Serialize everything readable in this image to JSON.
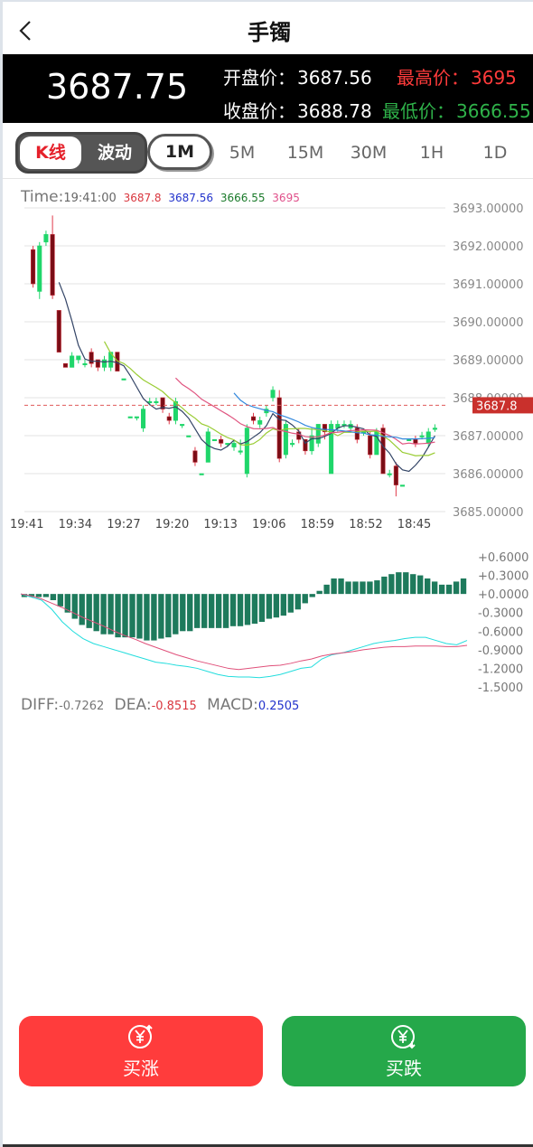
{
  "header": {
    "title": "手镯"
  },
  "quote": {
    "price": "3687.75",
    "open_label": "开盘价：",
    "open": "3687.56",
    "close_label": "收盘价：",
    "close": "3688.78",
    "high_label": "最高价：",
    "high": "3695",
    "low_label": "最低价：",
    "low": "3666.55"
  },
  "tabs": {
    "kline": "K线",
    "wave": "波动",
    "timeframes": [
      "1M",
      "5M",
      "15M",
      "30M",
      "1H",
      "1D"
    ],
    "active": "1M"
  },
  "legend": {
    "time_label": "Time:",
    "time": "19:41:00",
    "v1": "3687.8",
    "v2": "3687.56",
    "v3": "3666.55",
    "v4": "3695",
    "c1": "#d9363e",
    "c2": "#2233cc",
    "c3": "#1a7a2a",
    "c4": "#e0508a"
  },
  "chart_data": [
    {
      "type": "candlestick",
      "y_ticks": [
        "3693.00000",
        "3692.00000",
        "3691.00000",
        "3690.00000",
        "3689.00000",
        "3688.00000",
        "3687.00000",
        "3686.00000",
        "3685.00000"
      ],
      "ylim": [
        3685,
        3693
      ],
      "x_ticks": [
        "19:41",
        "19:34",
        "19:27",
        "19:20",
        "19:13",
        "19:06",
        "18:59",
        "18:52",
        "18:45"
      ],
      "current_price_label": "3687.8",
      "current_price": 3687.8,
      "colors": {
        "up": "#1fd66a",
        "down": "#7a0d16",
        "ma5": "#334466",
        "ma10": "#99cc33",
        "ma20": "#e05580",
        "ma30": "#3388dd"
      },
      "candles": [
        {
          "o": 3691.9,
          "c": 3691.0,
          "h": 3692.0,
          "l": 3690.9
        },
        {
          "o": 3690.8,
          "c": 3692.0,
          "h": 3692.1,
          "l": 3690.6
        },
        {
          "o": 3692.1,
          "c": 3692.3,
          "h": 3692.4,
          "l": 3692.0
        },
        {
          "o": 3692.3,
          "c": 3690.7,
          "h": 3692.8,
          "l": 3690.6
        },
        {
          "o": 3690.3,
          "c": 3689.2,
          "h": 3690.3,
          "l": 3689.2
        },
        {
          "o": 3688.9,
          "c": 3688.8,
          "h": 3688.9,
          "l": 3688.8
        },
        {
          "o": 3688.8,
          "c": 3689.1,
          "h": 3689.2,
          "l": 3688.8
        },
        {
          "o": 3689.0,
          "c": 3689.1,
          "h": 3689.1,
          "l": 3688.9
        },
        {
          "o": 3688.9,
          "c": 3688.9,
          "h": 3689.0,
          "l": 3688.8
        },
        {
          "o": 3689.2,
          "c": 3688.9,
          "h": 3689.3,
          "l": 3688.8
        },
        {
          "o": 3689.0,
          "c": 3688.8,
          "h": 3689.0,
          "l": 3688.7
        },
        {
          "o": 3688.8,
          "c": 3689.0,
          "h": 3689.1,
          "l": 3688.7
        },
        {
          "o": 3688.8,
          "c": 3689.2,
          "h": 3689.2,
          "l": 3688.7
        },
        {
          "o": 3689.2,
          "c": 3688.7,
          "h": 3689.2,
          "l": 3688.7
        },
        {
          "o": 3688.5,
          "c": 3688.5,
          "h": 3688.5,
          "l": 3688.5
        },
        {
          "o": 3687.5,
          "c": 3687.5,
          "h": 3687.5,
          "l": 3687.5
        },
        {
          "o": 3687.5,
          "c": 3687.5,
          "h": 3687.5,
          "l": 3687.4
        },
        {
          "o": 3687.2,
          "c": 3687.7,
          "h": 3687.8,
          "l": 3687.1
        },
        {
          "o": 3687.9,
          "c": 3687.9,
          "h": 3688.0,
          "l": 3687.8
        },
        {
          "o": 3687.9,
          "c": 3687.9,
          "h": 3688.0,
          "l": 3687.8
        },
        {
          "o": 3688.0,
          "c": 3687.7,
          "h": 3688.0,
          "l": 3687.6
        },
        {
          "o": 3687.5,
          "c": 3687.4,
          "h": 3687.6,
          "l": 3687.3
        },
        {
          "o": 3687.4,
          "c": 3687.9,
          "h": 3688.0,
          "l": 3687.3
        },
        {
          "o": 3687.3,
          "c": 3687.3,
          "h": 3687.3,
          "l": 3687.2
        },
        {
          "o": 3687.0,
          "c": 3687.0,
          "h": 3687.0,
          "l": 3687.0
        },
        {
          "o": 3686.6,
          "c": 3686.3,
          "h": 3686.7,
          "l": 3686.2
        },
        {
          "o": 3686.0,
          "c": 3686.0,
          "h": 3686.0,
          "l": 3686.0
        },
        {
          "o": 3686.3,
          "c": 3687.1,
          "h": 3687.2,
          "l": 3686.3
        },
        {
          "o": 3686.9,
          "c": 3686.9,
          "h": 3686.9,
          "l": 3686.9
        },
        {
          "o": 3686.9,
          "c": 3686.8,
          "h": 3687.0,
          "l": 3686.7
        },
        {
          "o": 3686.8,
          "c": 3686.8,
          "h": 3686.8,
          "l": 3686.7
        },
        {
          "o": 3686.7,
          "c": 3686.8,
          "h": 3686.9,
          "l": 3686.6
        },
        {
          "o": 3686.6,
          "c": 3686.6,
          "h": 3686.9,
          "l": 3686.5
        },
        {
          "o": 3686.0,
          "c": 3687.2,
          "h": 3687.3,
          "l": 3685.9
        },
        {
          "o": 3687.5,
          "c": 3687.4,
          "h": 3687.6,
          "l": 3687.3
        },
        {
          "o": 3687.3,
          "c": 3687.4,
          "h": 3687.5,
          "l": 3687.2
        },
        {
          "o": 3687.6,
          "c": 3687.7,
          "h": 3687.8,
          "l": 3687.5
        },
        {
          "o": 3688.0,
          "c": 3688.2,
          "h": 3688.3,
          "l": 3687.9
        },
        {
          "o": 3688.0,
          "c": 3686.4,
          "h": 3688.2,
          "l": 3686.3
        },
        {
          "o": 3686.5,
          "c": 3687.3,
          "h": 3687.4,
          "l": 3686.4
        },
        {
          "o": 3686.8,
          "c": 3686.8,
          "h": 3686.9,
          "l": 3686.7
        },
        {
          "o": 3687.1,
          "c": 3686.9,
          "h": 3687.2,
          "l": 3686.8
        },
        {
          "o": 3686.9,
          "c": 3686.6,
          "h": 3686.9,
          "l": 3686.5
        },
        {
          "o": 3686.6,
          "c": 3687.0,
          "h": 3687.2,
          "l": 3686.5
        },
        {
          "o": 3686.8,
          "c": 3687.3,
          "h": 3687.3,
          "l": 3686.7
        },
        {
          "o": 3687.3,
          "c": 3687.1,
          "h": 3687.3,
          "l": 3686.9
        },
        {
          "o": 3686.0,
          "c": 3687.3,
          "h": 3687.4,
          "l": 3686.0
        },
        {
          "o": 3687.2,
          "c": 3687.3,
          "h": 3687.4,
          "l": 3687.1
        },
        {
          "o": 3687.3,
          "c": 3687.3,
          "h": 3687.4,
          "l": 3687.2
        },
        {
          "o": 3687.2,
          "c": 3687.3,
          "h": 3687.4,
          "l": 3687.1
        },
        {
          "o": 3687.2,
          "c": 3686.9,
          "h": 3687.3,
          "l": 3686.8
        },
        {
          "o": 3687.1,
          "c": 3687.1,
          "h": 3687.1,
          "l": 3687.0
        },
        {
          "o": 3687.0,
          "c": 3686.5,
          "h": 3687.1,
          "l": 3686.4
        },
        {
          "o": 3686.5,
          "c": 3687.1,
          "h": 3687.2,
          "l": 3686.5
        },
        {
          "o": 3687.2,
          "c": 3686.0,
          "h": 3687.3,
          "l": 3686.0
        },
        {
          "o": 3686.0,
          "c": 3686.0,
          "h": 3686.1,
          "l": 3685.9
        },
        {
          "o": 3686.2,
          "c": 3685.7,
          "h": 3686.3,
          "l": 3685.4
        },
        {
          "o": 3685.7,
          "c": 3685.7,
          "h": 3685.7,
          "l": 3685.7
        },
        {
          "o": 3686.9,
          "c": 3686.9,
          "h": 3686.9,
          "l": 3686.9
        },
        {
          "o": 3686.9,
          "c": 3686.8,
          "h": 3687.0,
          "l": 3686.7
        },
        {
          "o": 3687.0,
          "c": 3687.0,
          "h": 3687.1,
          "l": 3686.9
        },
        {
          "o": 3686.8,
          "c": 3687.1,
          "h": 3687.2,
          "l": 3686.7
        },
        {
          "o": 3687.2,
          "c": 3687.2,
          "h": 3687.3,
          "l": 3687.1
        }
      ]
    },
    {
      "type": "bar",
      "title": "MACD",
      "y_ticks": [
        "+0.6000",
        "+0.3000",
        "+0.0000",
        "-0.3000",
        "-0.6000",
        "-0.9000",
        "-1.2000",
        "-1.5000"
      ],
      "ylim": [
        -1.5,
        0.6
      ],
      "colors": {
        "bar": "#1e7a5c",
        "diff": "#22dddd",
        "dea": "#e0507a"
      },
      "hist": [
        -0.05,
        -0.05,
        -0.05,
        -0.05,
        -0.1,
        -0.2,
        -0.3,
        -0.4,
        -0.5,
        -0.55,
        -0.6,
        -0.65,
        -0.65,
        -0.7,
        -0.7,
        -0.7,
        -0.72,
        -0.75,
        -0.75,
        -0.72,
        -0.7,
        -0.65,
        -0.6,
        -0.6,
        -0.55,
        -0.55,
        -0.55,
        -0.55,
        -0.55,
        -0.52,
        -0.52,
        -0.5,
        -0.48,
        -0.45,
        -0.4,
        -0.38,
        -0.35,
        -0.3,
        -0.25,
        -0.15,
        -0.05,
        0.05,
        0.15,
        0.25,
        0.25,
        0.2,
        0.2,
        0.2,
        0.2,
        0.22,
        0.28,
        0.32,
        0.35,
        0.35,
        0.32,
        0.3,
        0.25,
        0.2,
        0.15,
        0.15,
        0.2,
        0.25
      ],
      "diff": [
        0.0,
        -0.05,
        -0.1,
        -0.25,
        -0.45,
        -0.6,
        -0.72,
        -0.8,
        -0.85,
        -0.9,
        -0.95,
        -1.0,
        -1.05,
        -1.1,
        -1.12,
        -1.15,
        -1.17,
        -1.2,
        -1.25,
        -1.3,
        -1.33,
        -1.34,
        -1.34,
        -1.35,
        -1.33,
        -1.3,
        -1.25,
        -1.2,
        -1.18,
        -1.05,
        -0.98,
        -0.95,
        -0.9,
        -0.85,
        -0.8,
        -0.77,
        -0.75,
        -0.72,
        -0.7,
        -0.7,
        -0.75,
        -0.8,
        -0.82,
        -0.75
      ],
      "dea": [
        0.0,
        -0.03,
        -0.08,
        -0.15,
        -0.22,
        -0.3,
        -0.38,
        -0.45,
        -0.52,
        -0.6,
        -0.67,
        -0.73,
        -0.8,
        -0.86,
        -0.92,
        -0.98,
        -1.03,
        -1.08,
        -1.12,
        -1.16,
        -1.2,
        -1.22,
        -1.2,
        -1.18,
        -1.16,
        -1.15,
        -1.12,
        -1.08,
        -1.05,
        -1.0,
        -0.97,
        -0.95,
        -0.93,
        -0.9,
        -0.88,
        -0.86,
        -0.85,
        -0.85,
        -0.84,
        -0.84,
        -0.84,
        -0.85,
        -0.85,
        -0.83
      ]
    }
  ],
  "macd_legend": {
    "diff_label": "DIFF:",
    "diff": "-0.7262",
    "dea_label": "DEA:",
    "dea": "-0.8515",
    "macd_label": "MACD:",
    "macd": "0.2505"
  },
  "actions": {
    "buy_up": "买涨",
    "buy_down": "买跌",
    "buy_up_color": "#ff3c3c",
    "buy_down_color": "#25a84a",
    "up_icon": "yuan-up-icon",
    "down_icon": "yuan-down-icon"
  }
}
